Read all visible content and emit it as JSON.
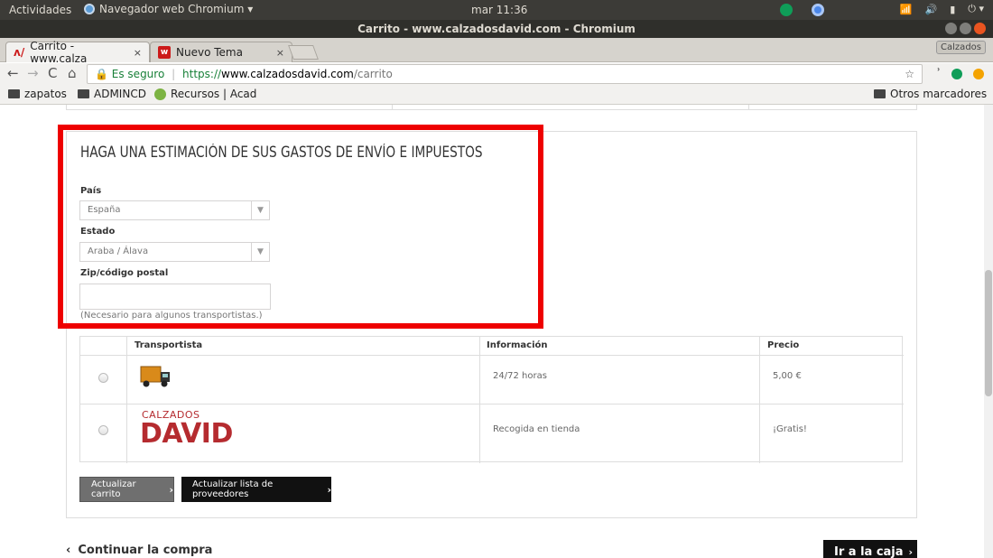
{
  "os": {
    "activities": "Actividades",
    "app_menu": "Navegador web Chromium ▾",
    "clock": "mar 11:36"
  },
  "window": {
    "title": "Carrito - www.calzadosdavid.com - Chromium"
  },
  "tabs": [
    {
      "label": "Carrito - www.calza",
      "close": "×"
    },
    {
      "label": "Nuevo Tema",
      "close": "×"
    }
  ],
  "profile_label": "Calzados",
  "omnibox": {
    "secure_label": "Es seguro",
    "scheme": "https://",
    "host": "www.calzadosdavid.com",
    "path": "/carrito"
  },
  "bookmarks": {
    "items": [
      "zapatos",
      "ADMINCD",
      "Recursos | Acad"
    ],
    "other": "Otros marcadores"
  },
  "shipping": {
    "title": "HAGA UNA ESTIMACIÓN DE SUS GASTOS DE ENVÍO E IMPUESTOS",
    "country_label": "País",
    "country_value": "España",
    "state_label": "Estado",
    "state_value": "Araba / Álava",
    "zip_label": "Zip/código postal",
    "zip_value": "",
    "zip_hint": "(Necesario para algunos transportistas.)"
  },
  "carriers": {
    "headers": [
      "Transportista",
      "Información",
      "Precio"
    ],
    "rows": [
      {
        "info": "24/72 horas",
        "price": "5,00 €"
      },
      {
        "info": "Recogida en tienda",
        "price": "¡Gratis!",
        "logo_top": "CALZADOS",
        "logo_main": "DAVID"
      }
    ]
  },
  "buttons": {
    "update_cart": "Actualizar carrito",
    "update_carriers": "Actualizar lista de proveedores",
    "continue_shopping": "Continuar la compra",
    "checkout": "Ir a la caja"
  },
  "colors": {
    "highlight": "#ee0000",
    "brand": "#b52b2f"
  }
}
